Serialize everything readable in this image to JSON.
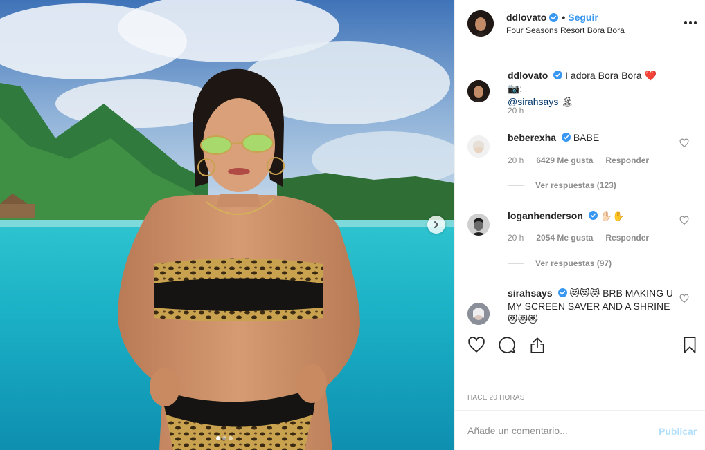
{
  "post": {
    "username": "ddlovato",
    "follow_label": "Seguir",
    "separator": "•",
    "location": "Four Seasons Resort Bora Bora",
    "time_ago": "HACE 20 HORAS"
  },
  "caption": {
    "username": "ddlovato",
    "text": "I adora Bora Bora ❤️ 📷:",
    "mention": "@sirahsays",
    "emoji": "🏝",
    "time": "20 h"
  },
  "comments": [
    {
      "username": "beberexha",
      "text": "BABE",
      "time": "20 h",
      "likes": "6429 Me gusta",
      "reply_label": "Responder",
      "view_replies": "Ver respuestas (123)"
    },
    {
      "username": "loganhenderson",
      "text": "✋🏻✋",
      "time": "20 h",
      "likes": "2054 Me gusta",
      "reply_label": "Responder",
      "view_replies": "Ver respuestas (97)"
    },
    {
      "username": "sirahsays",
      "text": "😻😻😻 BRB MAKING U MY SCREEN SAVER AND A SHRINE😻😻😻"
    }
  ],
  "composer": {
    "placeholder": "Añade un comentario...",
    "publish_label": "Publicar"
  },
  "carousel": {
    "slides": 3,
    "active": 1
  },
  "colors": {
    "accent": "#3897f0",
    "text": "#262626",
    "muted": "#8e8e8e",
    "publish_disabled": "#b2dffc"
  }
}
